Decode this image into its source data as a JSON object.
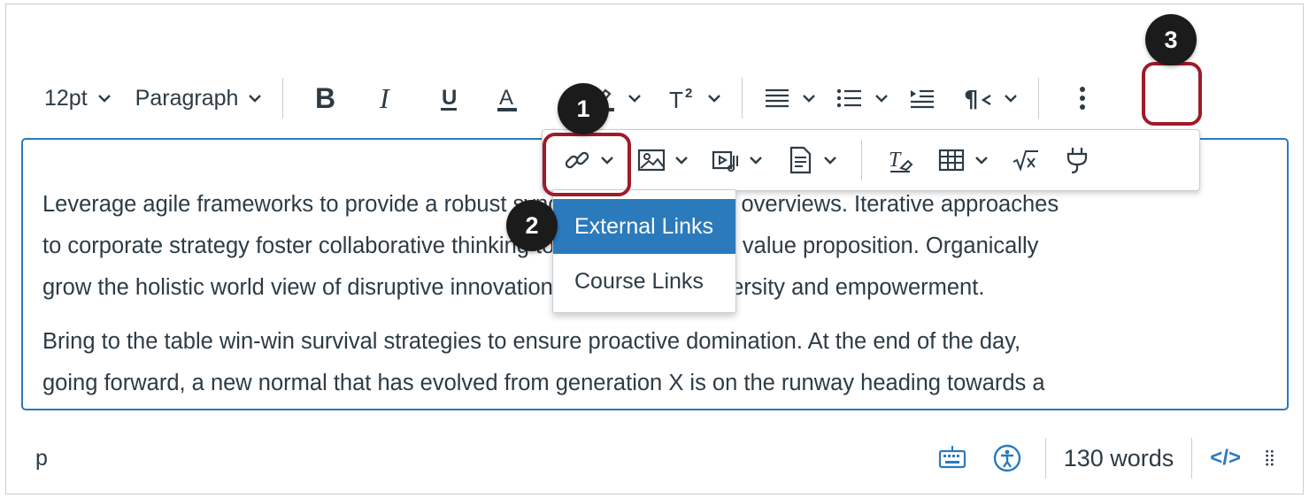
{
  "toolbar": {
    "font_size": "12pt",
    "block_format": "Paragraph",
    "bold_icon": "bold-icon",
    "italic_icon": "italic-icon",
    "underline_icon": "underline-icon",
    "text_color_icon": "text-color-icon",
    "highlight_icon": "highlight-icon",
    "superscript_icon": "superscript-icon",
    "align_icon": "align-icon",
    "list_icon": "list-icon",
    "indent_icon": "indent-icon",
    "direction_icon": "paragraph-direction-icon",
    "more_icon": "more-vertical-icon"
  },
  "overflow_toolbar": {
    "items": [
      "link-icon",
      "image-icon",
      "media-icon",
      "document-icon",
      "clear-format-icon",
      "table-icon",
      "equation-icon",
      "plugin-icon"
    ]
  },
  "link_menu": {
    "items": [
      "External Links",
      "Course Links"
    ]
  },
  "callouts": [
    "1",
    "2",
    "3"
  ],
  "editor": {
    "paragraph1_line1": "Leverage agile frameworks to provide a robust synopsis for high level overviews. Iterative approaches",
    "paragraph1_line2": "to corporate strategy foster collaborative thinking to further the overall value proposition. Organically",
    "paragraph1_line3": "grow the holistic world view of disruptive innovation via workplace diversity and empowerment.",
    "paragraph2_line1": "Bring to the table win-win survival strategies to ensure proactive domination. At the end of the day,",
    "paragraph2_line2": "going forward, a new normal that has evolved from generation X is on the runway heading towards a"
  },
  "status_bar": {
    "path": "p",
    "word_count": "130 words",
    "html_toggle": "</>"
  },
  "colors": {
    "accent": "#2b7abc",
    "callout_border": "#9e1b2a",
    "text": "#2d3b45"
  }
}
